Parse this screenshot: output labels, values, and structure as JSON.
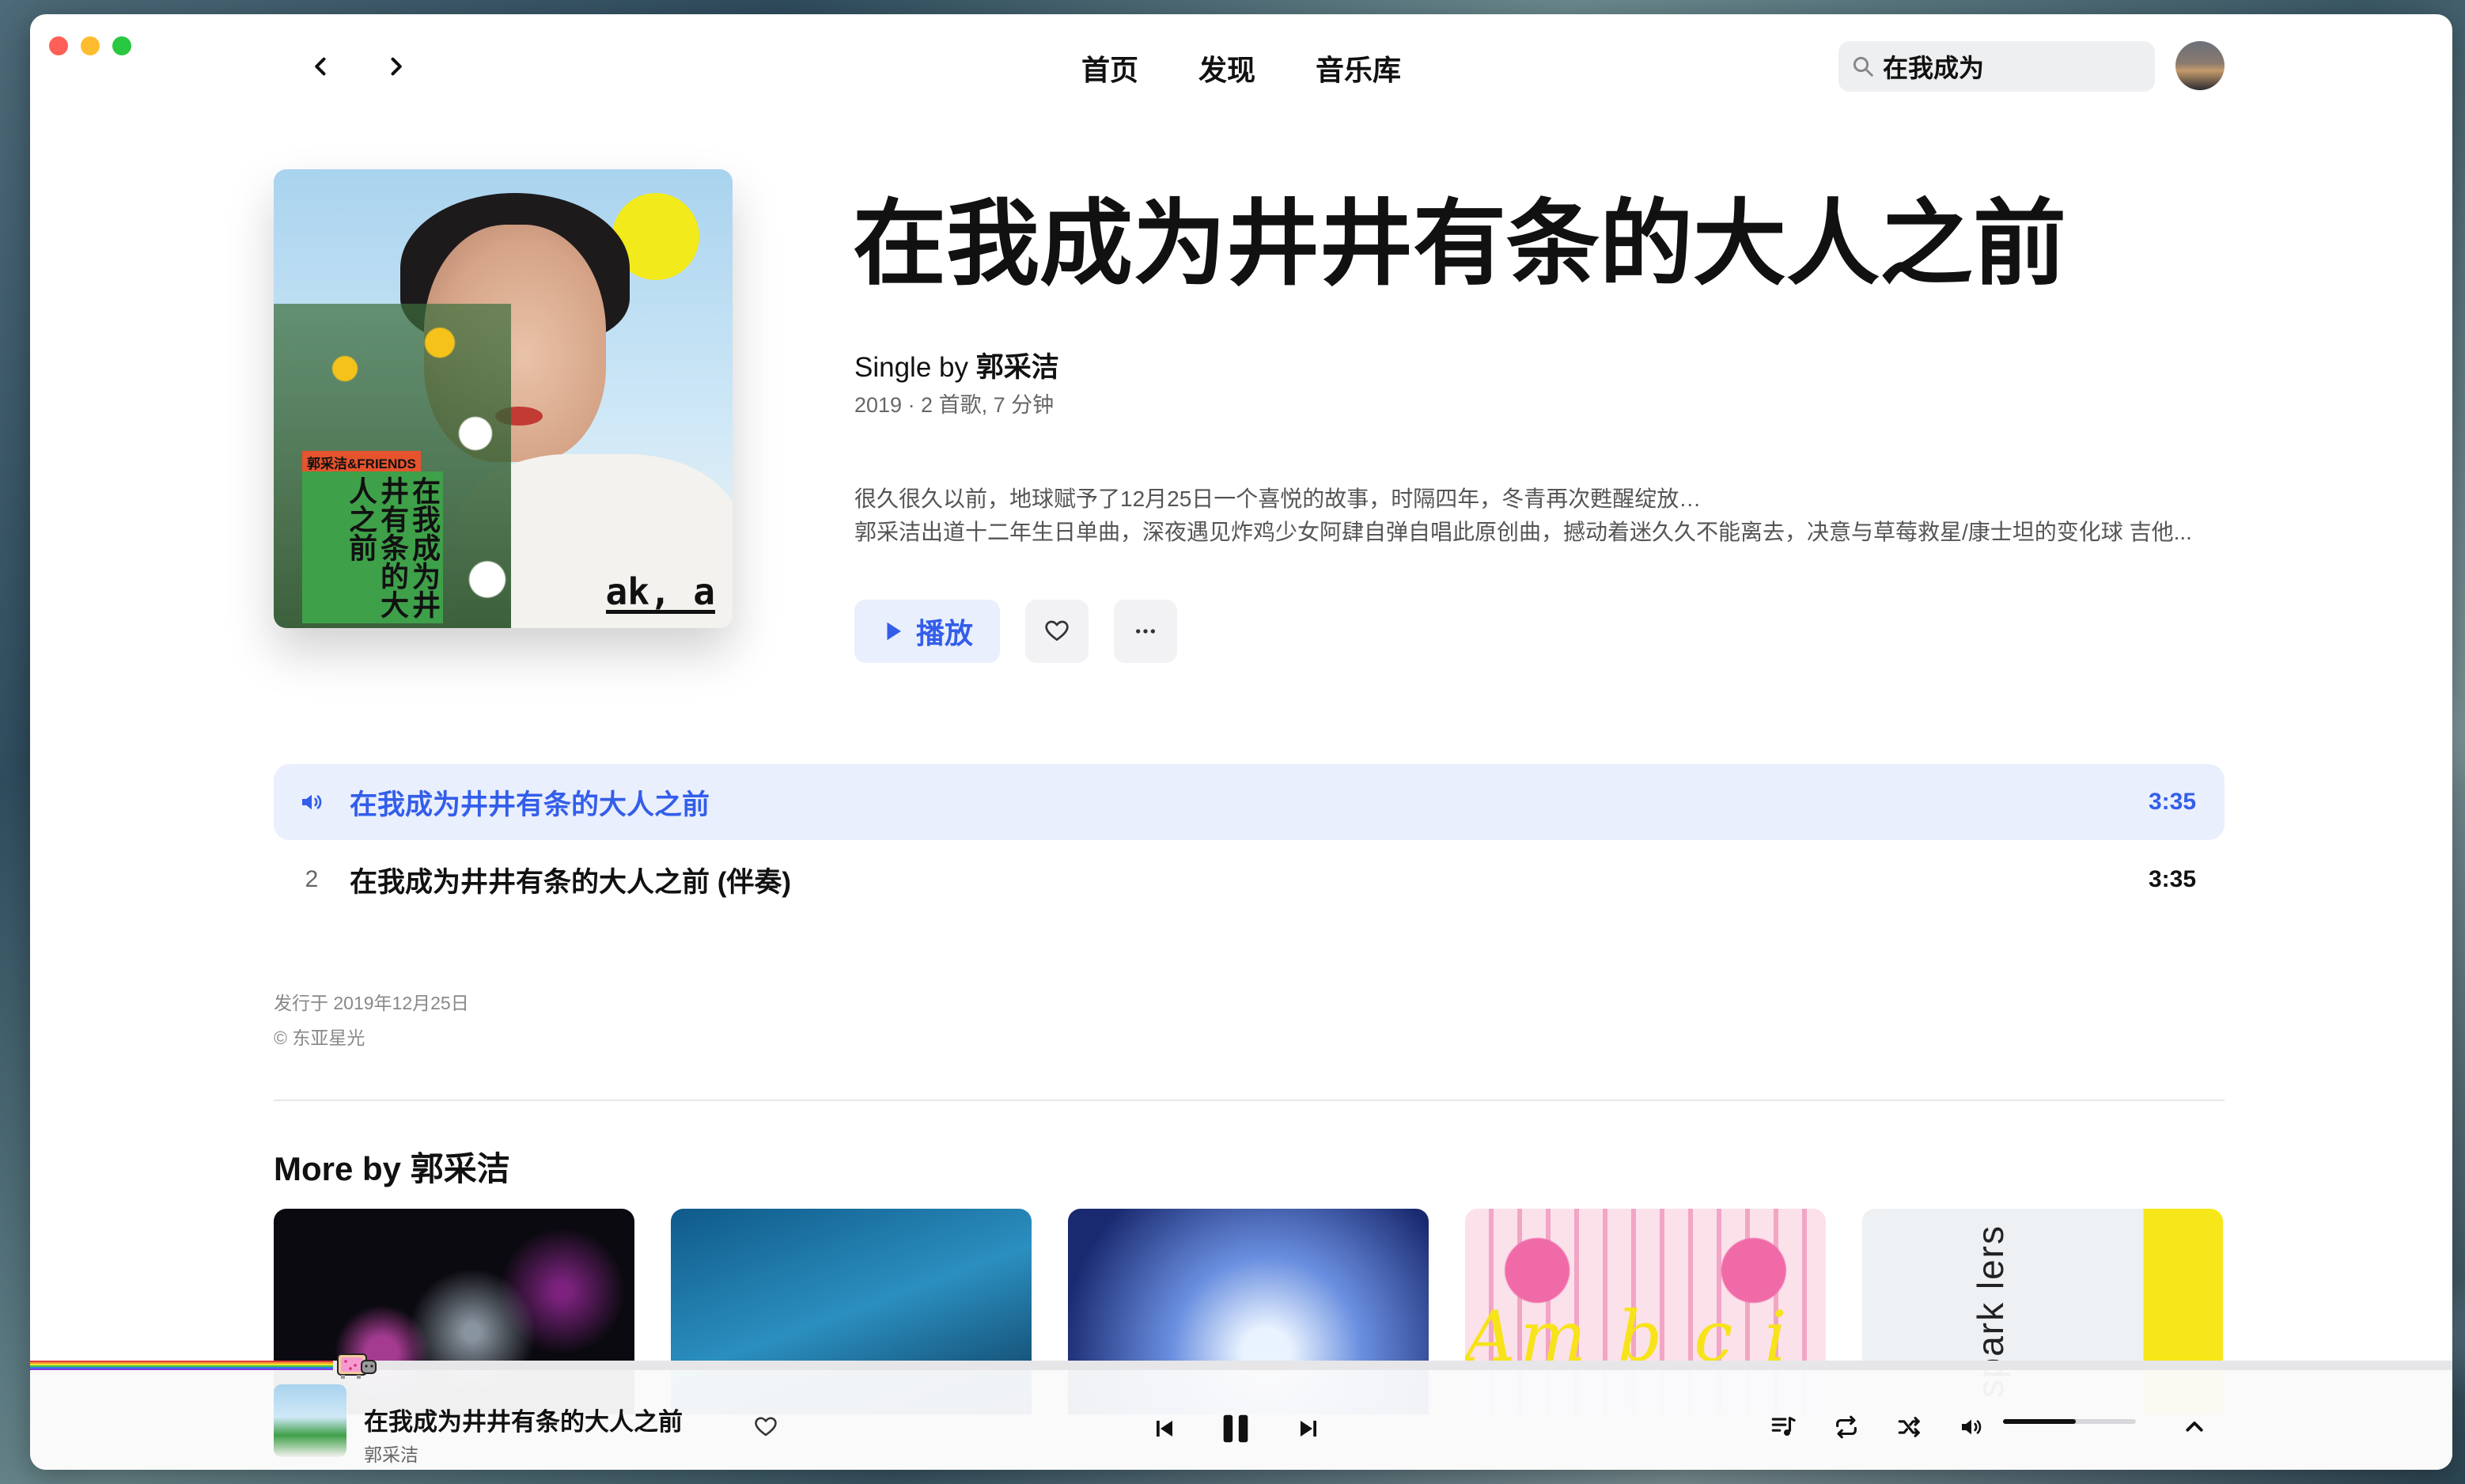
{
  "nav": {
    "links": [
      "首页",
      "发现",
      "音乐库"
    ],
    "search_value": "在我成为"
  },
  "album": {
    "title": "在我成为井井有条的大人之前",
    "type_by": "Single by",
    "artist": "郭采洁",
    "meta": "2019 · 2 首歌, 7 分钟",
    "description": [
      "很久很久以前，地球赋予了12月25日一个喜悦的故事，时隔四年，冬青再次甦醒绽放…",
      "郭采洁出道十二年生日单曲，深夜遇见炸鸡少女阿肆自弹自唱此原创曲，撼动着迷久久不能离去，决意与草莓救星/康士坦的变化球 吉他..."
    ],
    "play_label": "播放",
    "cover_text": {
      "tag": "郭采洁&FRIENDS",
      "vertical": "在我成为井井有条的大人之前",
      "mark": "ak, a"
    }
  },
  "tracks": [
    {
      "index": "",
      "name": "在我成为井井有条的大人之前",
      "duration": "3:35",
      "playing": true
    },
    {
      "index": "2",
      "name": "在我成为井井有条的大人之前 (伴奏)",
      "duration": "3:35",
      "playing": false
    }
  ],
  "release": {
    "date": "发行于 2019年12月25日",
    "label": "© 东亚星光"
  },
  "more": {
    "title": "More by 郭采洁",
    "album4_overlay": "Am b c i",
    "album5_text": "spark lers"
  },
  "player": {
    "title": "在我成为井井有条的大人之前",
    "artist": "郭采洁",
    "progress_fraction": 0.125,
    "volume_fraction": 0.55
  },
  "colors": {
    "accent": "#335eea",
    "accent_bg": "#eaeffd"
  },
  "icons": {
    "nav_back": "chevron-left-icon",
    "nav_forward": "chevron-right-icon",
    "search": "search-icon",
    "play": "play-icon",
    "like": "heart-icon",
    "more": "ellipsis-icon",
    "playing": "speaker-icon",
    "prev": "skip-back-icon",
    "pause": "pause-icon",
    "next": "skip-forward-icon",
    "queue": "queue-icon",
    "repeat": "repeat-icon",
    "shuffle": "shuffle-icon",
    "volume": "volume-icon",
    "expand": "chevron-up-icon"
  }
}
